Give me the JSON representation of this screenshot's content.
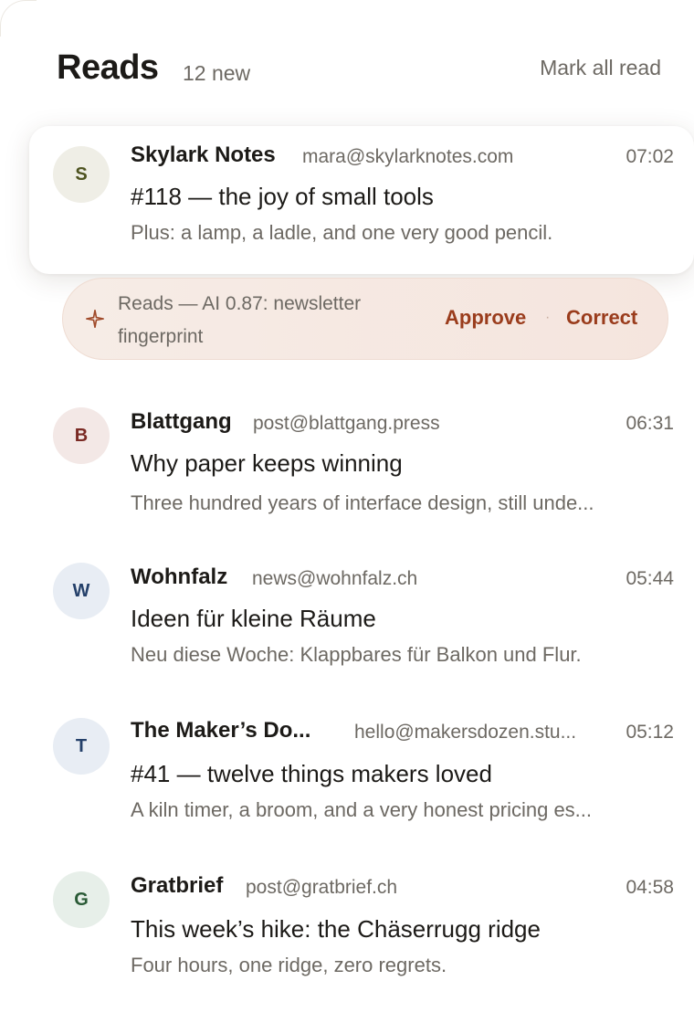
{
  "header": {
    "title": "Reads",
    "count": "12 new",
    "mark_all_label": "Mark all read"
  },
  "ai_suggestion": {
    "text": "Reads — AI 0.87: newsletter fingerprint",
    "approve_label": "Approve",
    "separator": "·",
    "correct_label": "Correct",
    "accent_color": "#9a3c1c",
    "icon": "sparkle-icon"
  },
  "messages": [
    {
      "initial": "S",
      "sender": "Skylark Notes",
      "email": "mara@skylarknotes.com",
      "time": "07:02",
      "subject": "#118 — the joy of small tools",
      "preview": "Plus: a lamp, a ladle, and one very good pencil.",
      "avatar_bg": "#efeee6",
      "avatar_fg": "#4e5320"
    },
    {
      "initial": "B",
      "sender": "Blattgang",
      "email": "post@blattgang.press",
      "time": "06:31",
      "subject": "Why paper keeps winning",
      "preview": "Three hundred years of interface design, still unde...",
      "avatar_bg": "#f3e8e6",
      "avatar_fg": "#7a2a24"
    },
    {
      "initial": "W",
      "sender": "Wohnfalz",
      "email": "news@wohnfalz.ch",
      "time": "05:44",
      "subject": "Ideen für kleine Räume",
      "preview": "Neu diese Woche: Klappbares für Balkon und Flur.",
      "avatar_bg": "#e8edf4",
      "avatar_fg": "#24406a"
    },
    {
      "initial": "T",
      "sender": "The Maker’s Do...",
      "email": "hello@makersdozen.stu...",
      "time": "05:12",
      "subject": "#41 — twelve things makers loved",
      "preview": "A kiln timer, a broom, and a very honest pricing es...",
      "avatar_bg": "#e8edf4",
      "avatar_fg": "#24406a"
    },
    {
      "initial": "G",
      "sender": "Gratbrief",
      "email": "post@gratbrief.ch",
      "time": "04:58",
      "subject": "This week’s hike: the Chäserrugg ridge",
      "preview": "Four hours, one ridge, zero regrets.",
      "avatar_bg": "#e7efe9",
      "avatar_fg": "#2a5a36"
    }
  ]
}
